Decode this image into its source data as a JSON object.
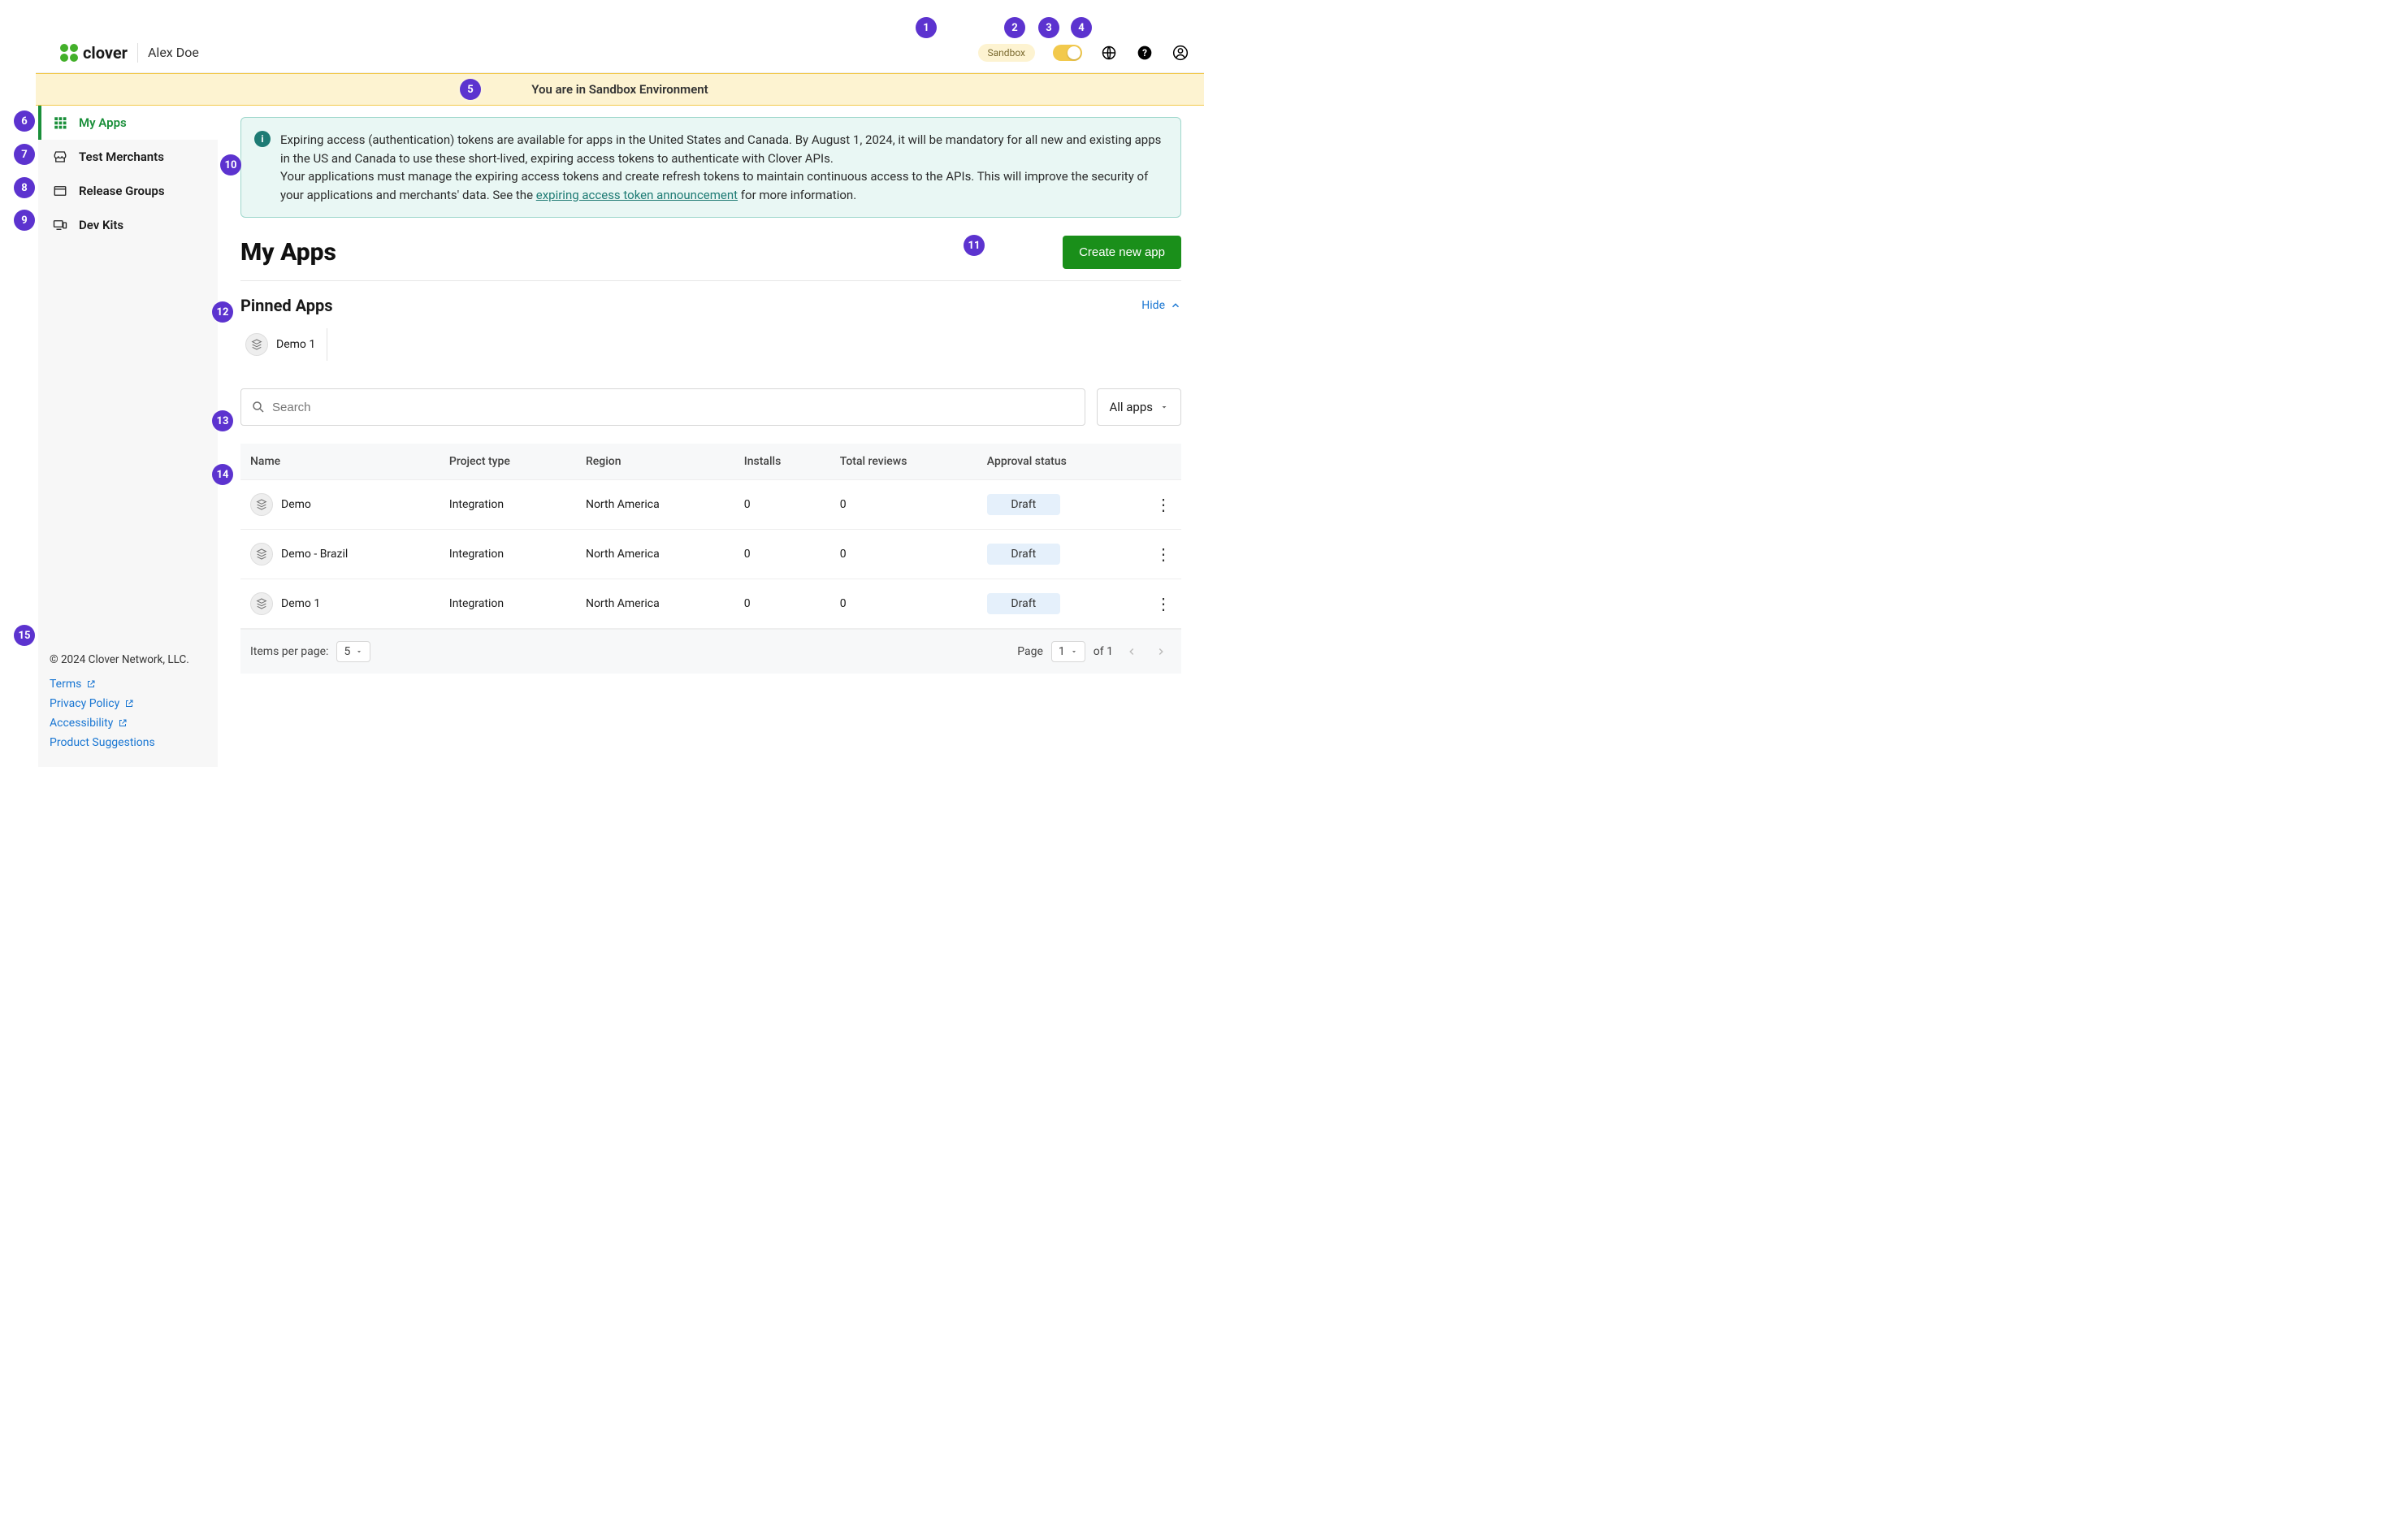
{
  "header": {
    "brand": "clover",
    "username": "Alex Doe",
    "sandbox_label": "Sandbox"
  },
  "env_banner": "You are in Sandbox Environment",
  "sidebar": {
    "items": [
      {
        "label": "My Apps",
        "active": true
      },
      {
        "label": "Test Merchants"
      },
      {
        "label": "Release Groups"
      },
      {
        "label": "Dev Kits"
      }
    ],
    "footer": {
      "copyright": "© 2024 Clover Network, LLC.",
      "links": [
        {
          "label": "Terms"
        },
        {
          "label": "Privacy Policy"
        },
        {
          "label": "Accessibility"
        },
        {
          "label": "Product Suggestions"
        }
      ]
    }
  },
  "info_banner": {
    "text1": "Expiring access (authentication) tokens are available for apps in the United States and Canada. By August 1, 2024, it will be mandatory for all new and existing apps in the US and Canada to use these short-lived, expiring access tokens to authenticate with Clover APIs.",
    "text2a": "Your applications must manage the expiring access tokens and create refresh tokens to maintain continuous access to the APIs. This will improve the security of your applications and merchants' data. See the ",
    "link": "expiring access token announcement",
    "text2b": " for more information."
  },
  "page": {
    "title": "My Apps",
    "create_label": "Create new app",
    "pinned_heading": "Pinned Apps",
    "hide_label": "Hide",
    "pinned": [
      {
        "name": "Demo 1"
      }
    ],
    "search_placeholder": "Search",
    "filter_label": "All apps",
    "table": {
      "columns": [
        "Name",
        "Project type",
        "Region",
        "Installs",
        "Total reviews",
        "Approval status"
      ],
      "rows": [
        {
          "name": "Demo",
          "project_type": "Integration",
          "region": "North America",
          "installs": "0",
          "reviews": "0",
          "status": "Draft"
        },
        {
          "name": "Demo - Brazil",
          "project_type": "Integration",
          "region": "North America",
          "installs": "0",
          "reviews": "0",
          "status": "Draft"
        },
        {
          "name": "Demo 1",
          "project_type": "Integration",
          "region": "North America",
          "installs": "0",
          "reviews": "0",
          "status": "Draft"
        }
      ],
      "footer": {
        "items_label": "Items per page:",
        "items_value": "5",
        "page_label": "Page",
        "page_value": "1",
        "of_text": "of 1"
      }
    }
  },
  "annotations": [
    "1",
    "2",
    "3",
    "4",
    "5",
    "6",
    "7",
    "8",
    "9",
    "10",
    "11",
    "12",
    "13",
    "14",
    "15"
  ]
}
